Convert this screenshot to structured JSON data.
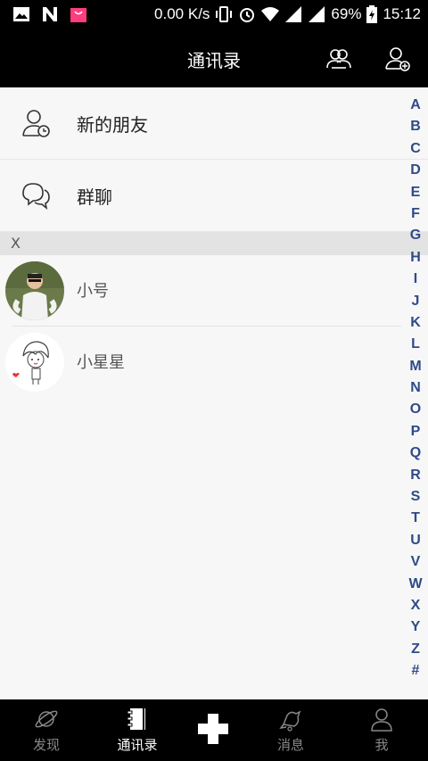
{
  "status_bar": {
    "speed": "0.00 K/s",
    "battery": "69%",
    "time": "15:12"
  },
  "header": {
    "title": "通讯录"
  },
  "fixed_items": [
    {
      "label": "新的朋友",
      "icon": "new-friend-icon"
    },
    {
      "label": "群聊",
      "icon": "group-chat-icon"
    }
  ],
  "section": {
    "letter": "X"
  },
  "contacts": [
    {
      "name": "小号"
    },
    {
      "name": "小星星"
    }
  ],
  "index_letters": [
    "A",
    "B",
    "C",
    "D",
    "E",
    "F",
    "G",
    "H",
    "I",
    "J",
    "K",
    "L",
    "M",
    "N",
    "O",
    "P",
    "Q",
    "R",
    "S",
    "T",
    "U",
    "V",
    "W",
    "X",
    "Y",
    "Z",
    "#"
  ],
  "bottom_nav": [
    {
      "label": "发现",
      "icon": "planet-icon",
      "active": false
    },
    {
      "label": "通讯录",
      "icon": "contacts-book-icon",
      "active": true
    },
    {
      "label": "消息",
      "icon": "message-bell-icon",
      "active": false
    },
    {
      "label": "我",
      "icon": "profile-icon",
      "active": false
    }
  ],
  "colors": {
    "bar_background": "#000000",
    "index_letter": "#2f4a8a",
    "section_header": "#e3e3e3"
  }
}
